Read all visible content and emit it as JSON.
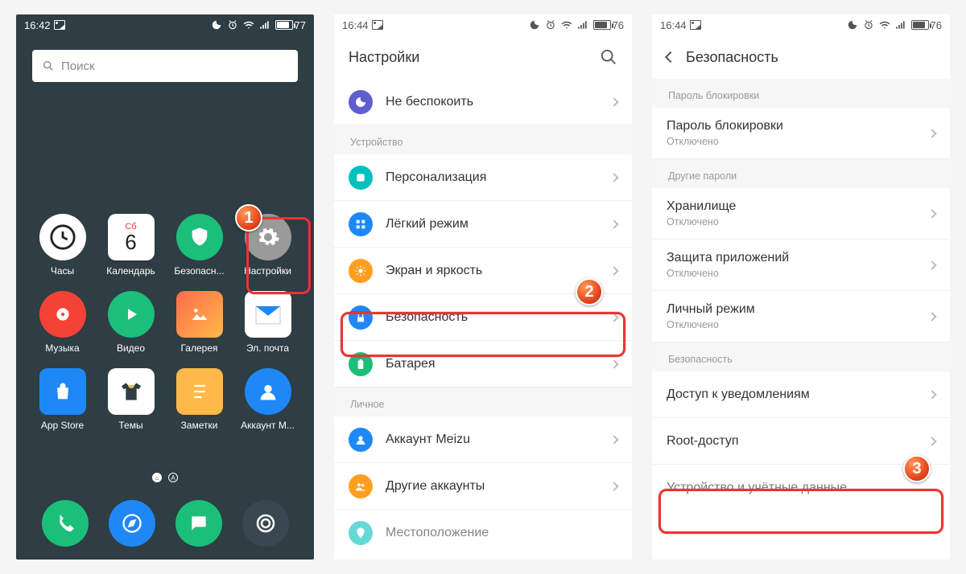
{
  "badges": {
    "one": "1",
    "two": "2",
    "three": "3"
  },
  "screen1": {
    "statusbar": {
      "time": "16:42",
      "battery": "77",
      "battery_pct": 77
    },
    "search_placeholder": "Поиск",
    "calendar": {
      "dow": "Сб",
      "day": "6"
    },
    "apps": [
      {
        "name": "clock",
        "label": "Часы"
      },
      {
        "name": "calendar",
        "label": "Календарь"
      },
      {
        "name": "security",
        "label": "Безопасн..."
      },
      {
        "name": "settings",
        "label": "Настройки"
      },
      {
        "name": "music",
        "label": "Музыка"
      },
      {
        "name": "video",
        "label": "Видео"
      },
      {
        "name": "gallery",
        "label": "Галерея"
      },
      {
        "name": "email",
        "label": "Эл. почта"
      },
      {
        "name": "appstore",
        "label": "App Store"
      },
      {
        "name": "themes",
        "label": "Темы"
      },
      {
        "name": "notes",
        "label": "Заметки"
      },
      {
        "name": "account",
        "label": "Аккаунт M..."
      }
    ],
    "dock": [
      {
        "name": "phone"
      },
      {
        "name": "browser"
      },
      {
        "name": "messages"
      },
      {
        "name": "camera"
      }
    ]
  },
  "screen2": {
    "statusbar": {
      "time": "16:44",
      "battery": "76",
      "battery_pct": 76
    },
    "header": {
      "title": "Настройки"
    },
    "rows": {
      "dnd": "Не беспокоить",
      "section_device": "Устройство",
      "personalization": "Персонализация",
      "easy_mode": "Лёгкий режим",
      "display": "Экран и яркость",
      "security": "Безопасность",
      "battery": "Батарея",
      "section_personal": "Личное",
      "meizu_account": "Аккаунт Meizu",
      "other_accounts": "Другие аккаунты",
      "location_cut": "Местоположение"
    }
  },
  "screen3": {
    "statusbar": {
      "time": "16:44",
      "battery": "76",
      "battery_pct": 76
    },
    "header": {
      "title": "Безопасность"
    },
    "sections": {
      "lock_pwd": "Пароль блокировки",
      "other_pwd": "Другие пароли",
      "security": "Безопасность"
    },
    "rows": {
      "lock_password": {
        "title": "Пароль блокировки",
        "sub": "Отключено"
      },
      "storage": {
        "title": "Хранилище",
        "sub": "Отключено"
      },
      "app_protection": {
        "title": "Защита приложений",
        "sub": "Отключено"
      },
      "private_mode": {
        "title": "Личный режим",
        "sub": "Отключено"
      },
      "notif_access": "Доступ к уведомлениям",
      "root": "Root-доступ",
      "device_cred": "Устройство и учётные данные"
    }
  },
  "colors": {
    "accent_blue": "#1e88f7",
    "green": "#1bbf7a",
    "orange": "#ff9f1f",
    "teal": "#00c1bd",
    "purple": "#5e5ecf",
    "red": "#f44336",
    "grey": "#9a9a9a",
    "highlight": "#e33"
  }
}
